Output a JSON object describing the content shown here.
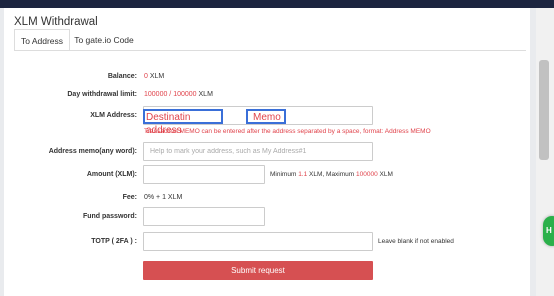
{
  "title": "XLM Withdrawal",
  "tabs": [
    {
      "label": "To Address",
      "active": true
    },
    {
      "label": "To gate.io Code",
      "active": false
    }
  ],
  "balance": {
    "label": "Balance:",
    "value": "0",
    "unit": "XLM"
  },
  "daily_limit": {
    "label": "Day withdrawal limit:",
    "used": "100000",
    "sep": " / ",
    "total": "100000",
    "unit": "XLM"
  },
  "address": {
    "label": "XLM Address:",
    "annotation_address": "Destinatin address",
    "annotation_memo": "Memo",
    "hint": "Transaction MEMO can be entered after the address separated by a space, format: Address MEMO"
  },
  "memo": {
    "label": "Address memo(any word):",
    "placeholder": "Help to mark your address, such as My Address#1"
  },
  "amount": {
    "label": "Amount (XLM):",
    "min_prefix": "Minimum",
    "min_value": "1.1",
    "min_unit": "XLM, Maximum",
    "max_value": "100000",
    "max_unit": "XLM"
  },
  "fee": {
    "label": "Fee:",
    "value": "0% + 1 XLM"
  },
  "fund_password": {
    "label": "Fund password:"
  },
  "totp": {
    "label": "TOTP ( 2FA ) :",
    "note": "Leave blank if not enabled"
  },
  "submit_label": "Submit request",
  "colors": {
    "accent_red": "#e0434b",
    "button_red": "#d65052",
    "annotation_blue": "#3a6fd8",
    "topbar": "#1c2540"
  }
}
